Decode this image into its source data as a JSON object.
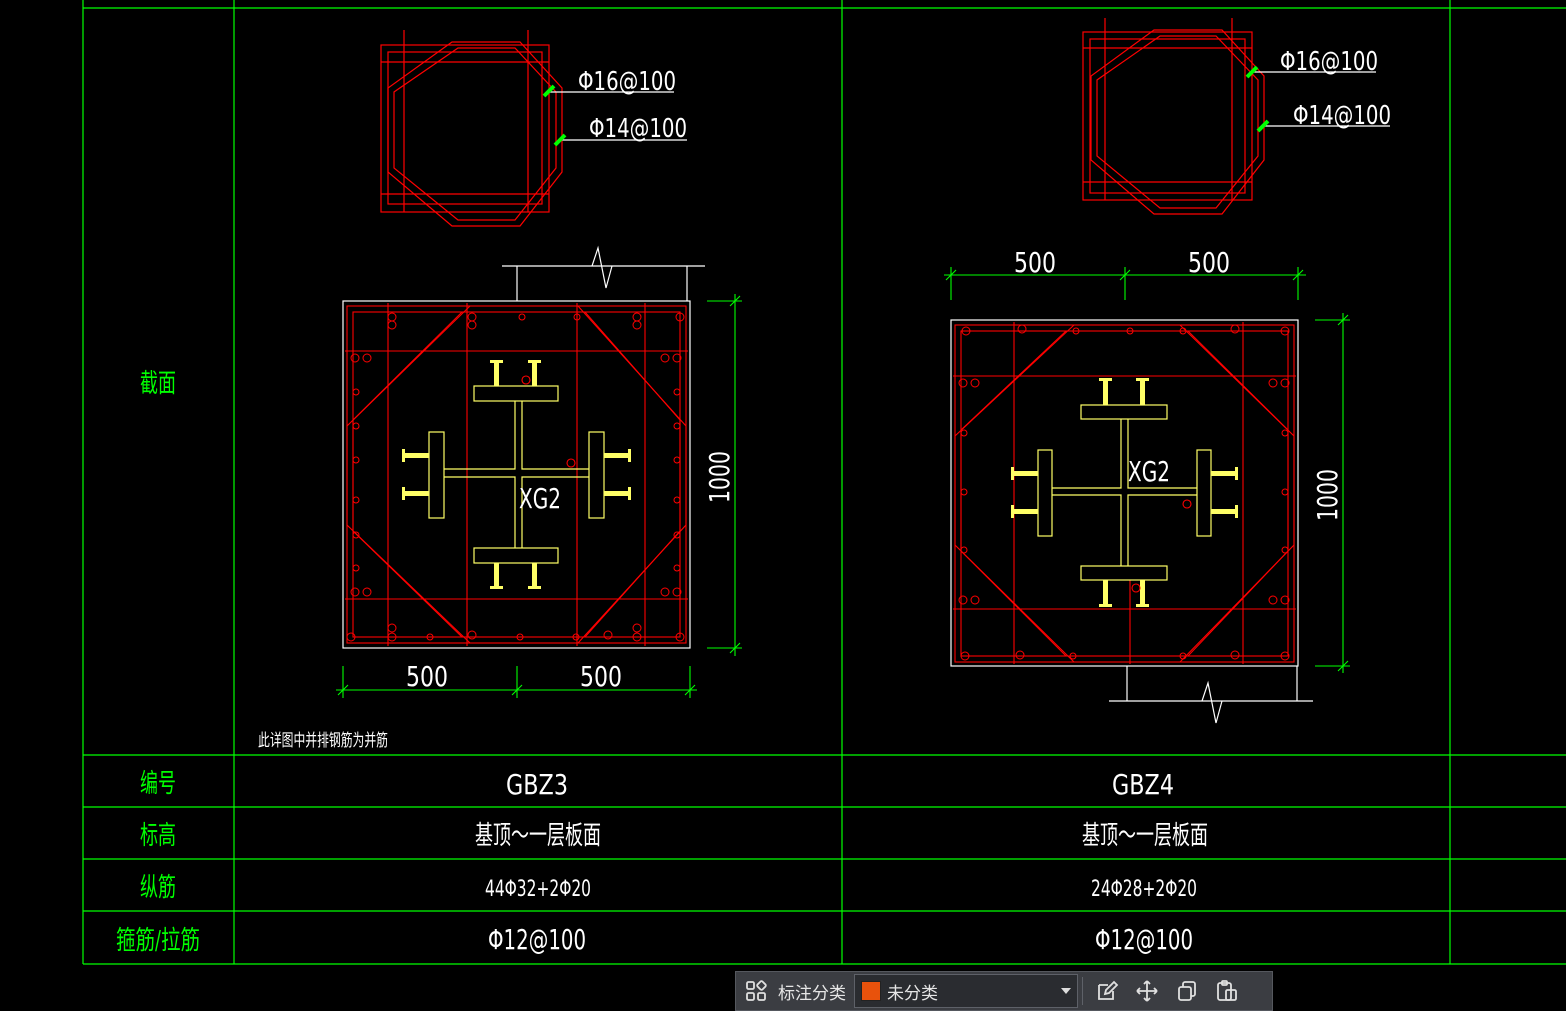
{
  "table": {
    "row_headers": {
      "section": "截面",
      "number": "编号",
      "elevation": "标高",
      "long_rebar": "纵筋",
      "stirrup": "箍筋/拉筋"
    },
    "columns": [
      {
        "number": "GBZ3",
        "elevation": "基顶～一层板面",
        "long_rebar": "44Φ32+2Φ20",
        "stirrup": "Φ12@100",
        "detail_top": "Φ16@100",
        "detail_bottom": "Φ14@100",
        "steel_label": "XG2",
        "dim_left": "500",
        "dim_right": "500",
        "dim_height": "1000",
        "note": "此详图中并排钢筋为并筋"
      },
      {
        "number": "GBZ4",
        "elevation": "基顶～一层板面",
        "long_rebar": "24Φ28+2Φ20",
        "stirrup": "Φ12@100",
        "detail_top": "Φ16@100",
        "detail_bottom": "Φ14@100",
        "steel_label": "XG2",
        "dim_left": "500",
        "dim_right": "500",
        "dim_height": "1000"
      }
    ]
  },
  "toolbar": {
    "category_label": "标注分类",
    "category_value": "未分类",
    "category_color": "#e8520c",
    "icons": [
      "grid-icon",
      "edit-icon",
      "move-icon",
      "copy-icon",
      "paste-icon"
    ]
  },
  "colors": {
    "background": "#000000",
    "grid": "#00ff00",
    "text": "#ffffff",
    "row_header_text": "#00ff00",
    "rebar": "#ff0000",
    "steel": "#ffff66",
    "marker": "#00ff00"
  }
}
